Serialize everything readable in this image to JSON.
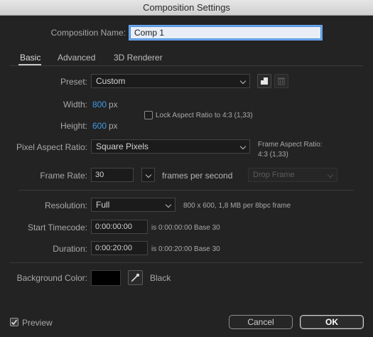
{
  "window": {
    "title": "Composition Settings"
  },
  "composition_name": {
    "label": "Composition Name:",
    "value": "Comp 1"
  },
  "tabs": [
    {
      "label": "Basic",
      "active": true
    },
    {
      "label": "Advanced",
      "active": false
    },
    {
      "label": "3D Renderer",
      "active": false
    }
  ],
  "preset": {
    "label": "Preset:",
    "value": "Custom",
    "save_icon": "floppy-icon",
    "delete_icon": "trash-icon"
  },
  "width": {
    "label": "Width:",
    "value": "800",
    "unit": "px"
  },
  "height": {
    "label": "Height:",
    "value": "600",
    "unit": "px"
  },
  "lock_aspect": {
    "label": "Lock Aspect Ratio to 4:3 (1,33)",
    "checked": false
  },
  "pixel_aspect": {
    "label": "Pixel Aspect Ratio:",
    "value": "Square Pixels"
  },
  "frame_aspect": {
    "label": "Frame Aspect Ratio:",
    "value": "4:3 (1,33)"
  },
  "frame_rate": {
    "label": "Frame Rate:",
    "value": "30",
    "unit": "frames per second",
    "drop_frame": "Drop Frame"
  },
  "resolution": {
    "label": "Resolution:",
    "value": "Full",
    "info": "800 x 600, 1,8 MB per 8bpc frame"
  },
  "start_timecode": {
    "label": "Start Timecode:",
    "value": "0:00:00:00",
    "info": "is 0:00:00:00  Base 30"
  },
  "duration": {
    "label": "Duration:",
    "value": "0:00:20:00",
    "info": "is 0:00:20:00  Base 30"
  },
  "background_color": {
    "label": "Background Color:",
    "swatch_color": "#000000",
    "name": "Black"
  },
  "preview": {
    "label": "Preview",
    "checked": true
  },
  "buttons": {
    "cancel": "Cancel",
    "ok": "OK"
  }
}
